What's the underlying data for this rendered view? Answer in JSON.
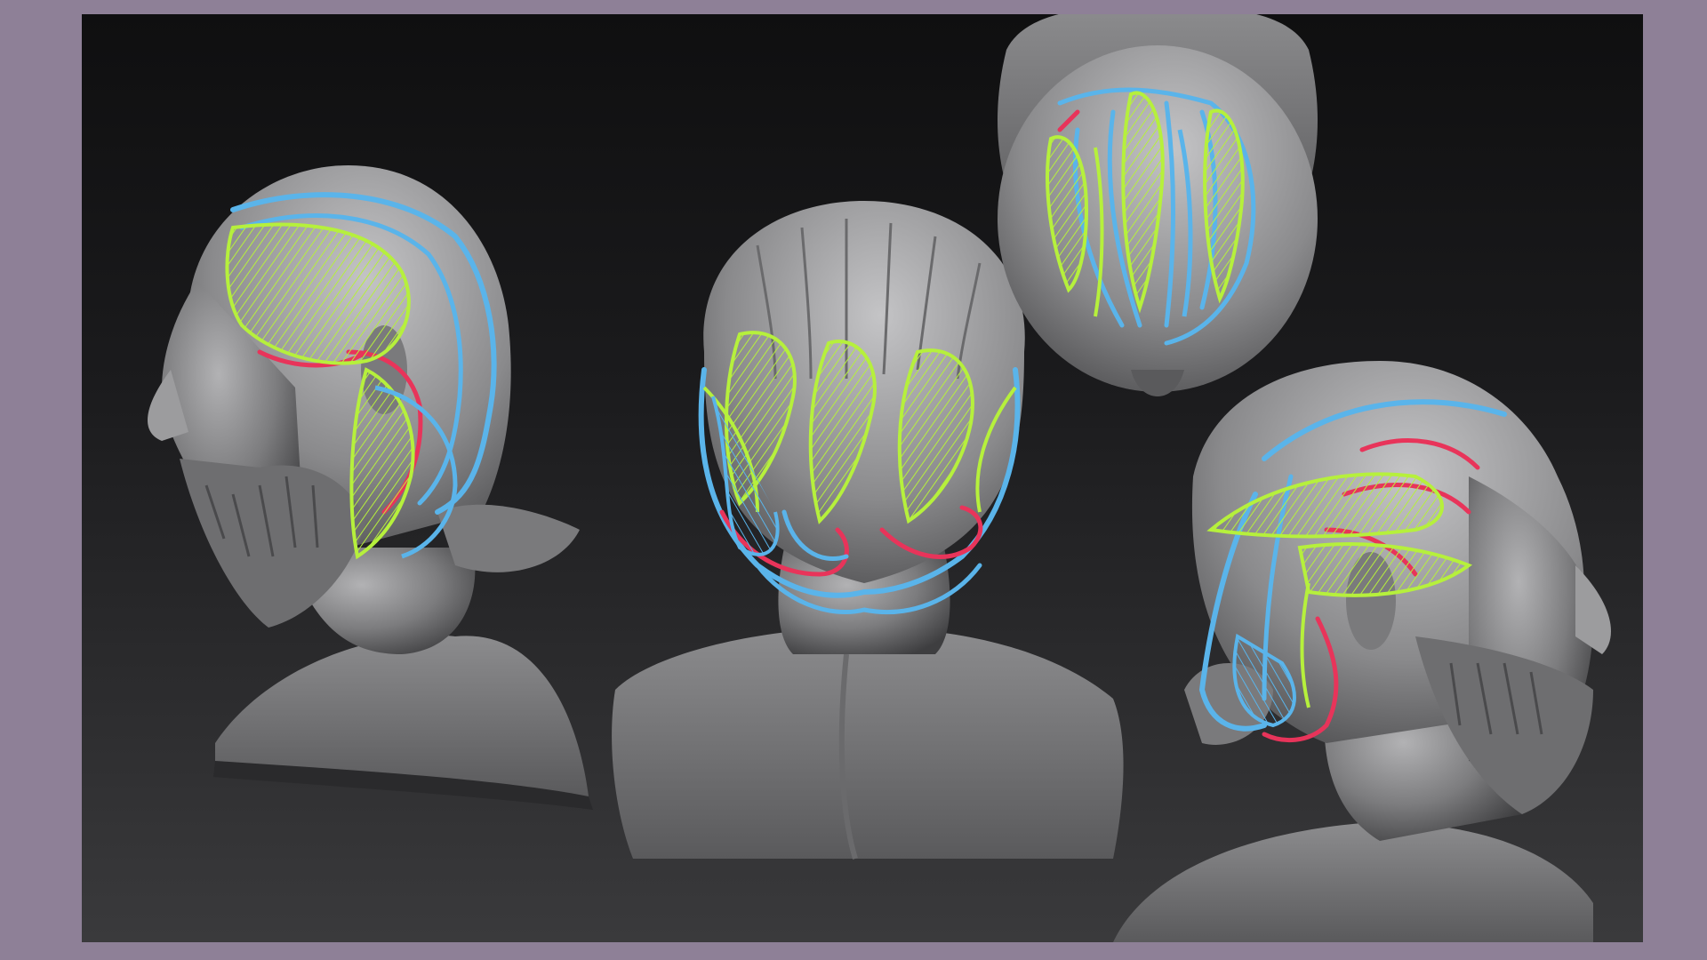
{
  "scene": {
    "description_colors": {
      "frame_border": "#8e8097",
      "background_top": "#0f0f10",
      "background_bottom": "#3a3a3c",
      "clay": "#8a8a8c",
      "stroke_green": "#b6f03c",
      "stroke_blue": "#5ab4ea",
      "stroke_red": "#e8345a"
    },
    "views": [
      {
        "name": "left-profile"
      },
      {
        "name": "back"
      },
      {
        "name": "top"
      },
      {
        "name": "right-three-quarter"
      }
    ]
  }
}
